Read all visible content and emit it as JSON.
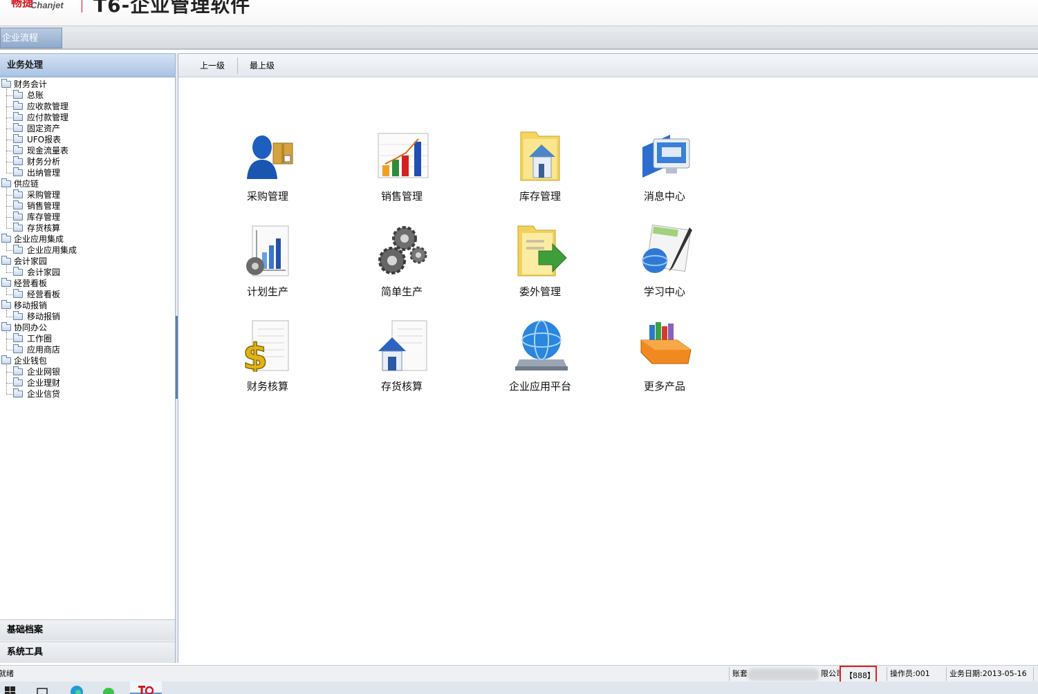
{
  "header": {
    "brand_cn": "畅捷",
    "brand_en": "Chanjet",
    "title": "T6-企业管理软件"
  },
  "tabs": [
    {
      "label": "企业流程"
    }
  ],
  "left_panel": {
    "title": "业务处理",
    "tree": [
      {
        "label": "财务会计",
        "level": 0
      },
      {
        "label": "总账",
        "level": 1
      },
      {
        "label": "应收款管理",
        "level": 1
      },
      {
        "label": "应付款管理",
        "level": 1
      },
      {
        "label": "固定资产",
        "level": 1
      },
      {
        "label": "UFO报表",
        "level": 1
      },
      {
        "label": "现金流量表",
        "level": 1
      },
      {
        "label": "财务分析",
        "level": 1
      },
      {
        "label": "出纳管理",
        "level": 1
      },
      {
        "label": "供应链",
        "level": 0
      },
      {
        "label": "采购管理",
        "level": 1
      },
      {
        "label": "销售管理",
        "level": 1
      },
      {
        "label": "库存管理",
        "level": 1
      },
      {
        "label": "存货核算",
        "level": 1
      },
      {
        "label": "企业应用集成",
        "level": 0
      },
      {
        "label": "企业应用集成",
        "level": 1
      },
      {
        "label": "会计家园",
        "level": 0
      },
      {
        "label": "会计家园",
        "level": 1
      },
      {
        "label": "经营看板",
        "level": 0
      },
      {
        "label": "经营看板",
        "level": 1
      },
      {
        "label": "移动报销",
        "level": 0
      },
      {
        "label": "移动报销",
        "level": 1
      },
      {
        "label": "协同办公",
        "level": 0
      },
      {
        "label": "工作圈",
        "level": 1
      },
      {
        "label": "应用商店",
        "level": 1
      },
      {
        "label": "企业钱包",
        "level": 0
      },
      {
        "label": "企业网银",
        "level": 1
      },
      {
        "label": "企业理财",
        "level": 1
      },
      {
        "label": "企业信贷",
        "level": 1
      }
    ],
    "footer_sections": [
      "基础档案",
      "系统工具"
    ]
  },
  "toolbar": {
    "up_label": "上一级",
    "top_label": "最上级"
  },
  "apps": [
    {
      "label": "采购管理",
      "icon": "purchase-person-box-icon"
    },
    {
      "label": "销售管理",
      "icon": "sales-bar-chart-icon"
    },
    {
      "label": "库存管理",
      "icon": "inventory-folder-house-icon"
    },
    {
      "label": "消息中心",
      "icon": "message-monitor-icon"
    },
    {
      "label": "计划生产",
      "icon": "plan-chart-gear-icon"
    },
    {
      "label": "简单生产",
      "icon": "gears-icon"
    },
    {
      "label": "委外管理",
      "icon": "outsource-folder-arrow-icon"
    },
    {
      "label": "学习中心",
      "icon": "learning-globe-pen-icon"
    },
    {
      "label": "财务核算",
      "icon": "finance-dollar-doc-icon"
    },
    {
      "label": "存货核算",
      "icon": "stock-house-doc-icon"
    },
    {
      "label": "企业应用平台",
      "icon": "platform-globe-disk-icon"
    },
    {
      "label": "更多产品",
      "icon": "more-products-books-icon"
    }
  ],
  "statusbar": {
    "ready": "就绪",
    "account_prefix": "账套",
    "account_suffix": "限公司",
    "account_code": "【888】",
    "operator": "操作员:001",
    "business_date": "业务日期:2013-05-16"
  },
  "colors": {
    "brand_red": "#d7141f",
    "panel_blue": "#a9c2e2",
    "highlight_box": "#e02020"
  }
}
